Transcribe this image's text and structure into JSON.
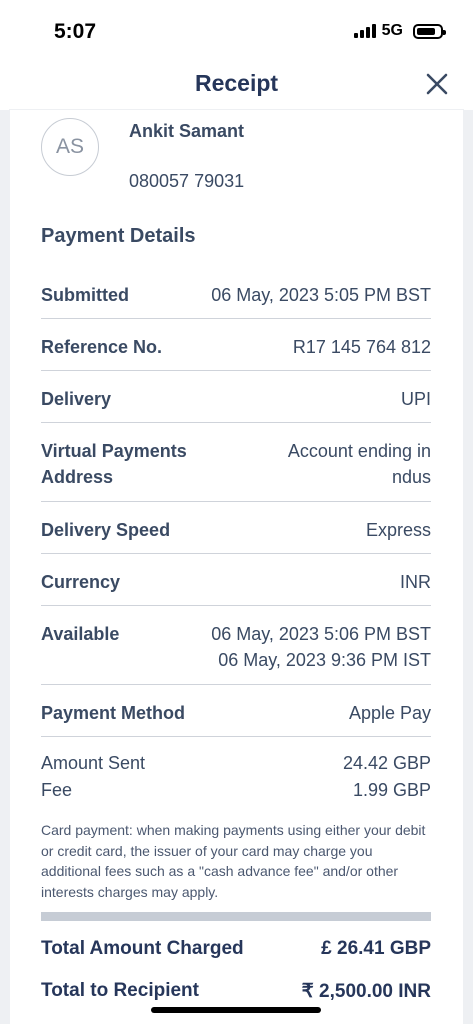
{
  "status_bar": {
    "time": "5:07",
    "network": "5G"
  },
  "header": {
    "title": "Receipt"
  },
  "recipient": {
    "initials": "AS",
    "name": "Ankit Samant",
    "phone": "080057 79031"
  },
  "payment_details": {
    "title": "Payment Details",
    "rows": [
      {
        "label": "Submitted",
        "value": "06 May, 2023 5:05 PM BST"
      },
      {
        "label": "Reference No.",
        "value": "R17 145 764 812"
      },
      {
        "label": "Delivery",
        "value": "UPI"
      },
      {
        "label_line1": "Virtual Payments",
        "label_line2": "Address",
        "value_line1": "Account ending in",
        "value_line2": "ndus"
      },
      {
        "label": "Delivery Speed",
        "value": "Express"
      },
      {
        "label": "Currency",
        "value": "INR"
      },
      {
        "label": "Available",
        "value_line1": "06 May, 2023 5:06 PM BST",
        "value_line2": "06 May, 2023 9:36 PM IST"
      },
      {
        "label": "Payment Method",
        "value": "Apple Pay"
      }
    ]
  },
  "amounts": {
    "sent_label": "Amount Sent",
    "sent_value": "24.42 GBP",
    "fee_label": "Fee",
    "fee_value": "1.99 GBP"
  },
  "note": "Card payment: when making payments using either your debit or credit card, the issuer of your card may charge you additional fees such as a \"cash advance fee\" and/or other interests charges may apply.",
  "totals": {
    "charged_label": "Total Amount Charged",
    "charged_value": "£ 26.41 GBP",
    "recipient_label": "Total to Recipient",
    "recipient_value": "₹ 2,500.00 INR"
  }
}
